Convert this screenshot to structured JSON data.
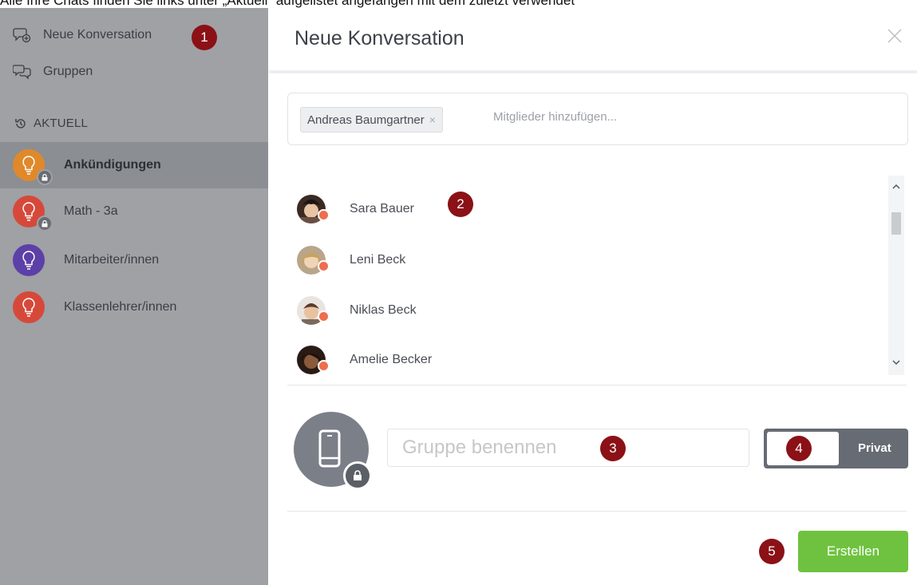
{
  "doc_line": "Alle Ihre Chats finden Sie links unter „Aktuell“ aufgelistet angefangen mit dem zuletzt verwendet",
  "sidebar": {
    "new_conversation": "Neue Konversation",
    "groups": "Gruppen",
    "section_title": "AKTUELL",
    "chats": [
      {
        "label": "Ankündigungen",
        "color": "#e0892b",
        "active": true,
        "locked": true
      },
      {
        "label": "Math - 3a",
        "color": "#d6493a",
        "active": false,
        "locked": true
      },
      {
        "label": "Mitarbeiter/innen",
        "color": "#5d3fa8",
        "active": false,
        "locked": false
      },
      {
        "label": "Klassenlehrer/innen",
        "color": "#d6493a",
        "active": false,
        "locked": false
      }
    ]
  },
  "modal": {
    "title": "Neue Konversation",
    "member_chip": "Andreas Baumgartner",
    "member_chip_remove": "×",
    "members_placeholder": "Mitglieder hinzufügen...",
    "contacts": [
      {
        "name": "Sara Bauer"
      },
      {
        "name": "Leni Beck"
      },
      {
        "name": "Niklas Beck"
      },
      {
        "name": "Amelie Becker"
      }
    ],
    "group_name_placeholder": "Gruppe benennen",
    "privacy_label": "Privat",
    "create_button": "Erstellen"
  },
  "markers": [
    "1",
    "2",
    "3",
    "4",
    "5"
  ],
  "colors": {
    "sidebar_bg": "#9fa1a5",
    "marker": "#8b1116",
    "create_button": "#6fc23f",
    "status_dot": "#ee6e4f"
  }
}
